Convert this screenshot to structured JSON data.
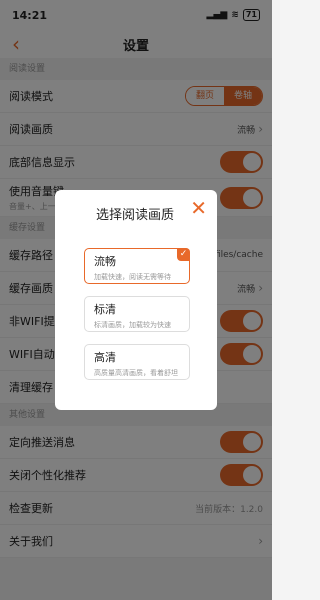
{
  "status": {
    "time": "14:21",
    "battery": "71"
  },
  "header": {
    "title": "设置",
    "back_icon": "chevron-left-icon"
  },
  "sections": {
    "reading": "阅读设置",
    "cache": "缓存设置",
    "other": "其他设置"
  },
  "reading": {
    "mode_label": "阅读模式",
    "mode_options": [
      "翻页",
      "卷轴"
    ],
    "mode_selected": "卷轴",
    "quality_label": "阅读画质",
    "quality_value": "流畅",
    "bottom_info_label": "底部信息显示",
    "volume_label": "使用音量键",
    "volume_sub": "音量+、上一"
  },
  "cache": {
    "path_label": "缓存路径",
    "path_value": "files/cache",
    "quality_label": "缓存画质",
    "quality_value": "流畅",
    "non_wifi_label": "非WIFI提醒",
    "wifi_auto_label": "WIFI自动缓存",
    "clear_label": "清理缓存"
  },
  "other": {
    "push_label": "定向推送消息",
    "personalize_label": "关闭个性化推荐",
    "update_label": "检查更新",
    "version_text": "当前版本：1.2.0",
    "about_label": "关于我们"
  },
  "dialog": {
    "title": "选择阅读画质",
    "close_icon": "close-icon",
    "options": [
      {
        "name": "流畅",
        "desc": "加载快速，阅读无需等待",
        "selected": true
      },
      {
        "name": "标清",
        "desc": "标清画质，加载较为快速",
        "selected": false
      },
      {
        "name": "高清",
        "desc": "高质量高清画质，看着舒坦",
        "selected": false
      }
    ]
  },
  "colors": {
    "accent": "#e8692a"
  }
}
